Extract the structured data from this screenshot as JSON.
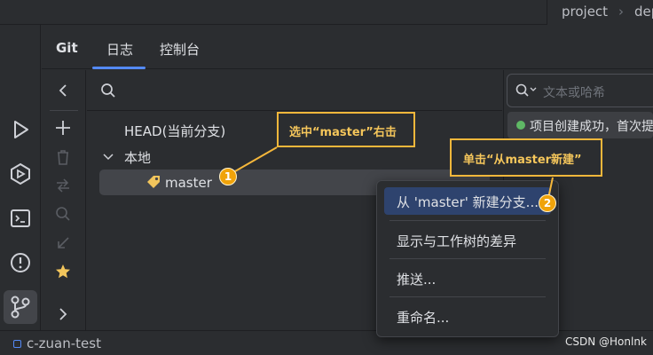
{
  "topbar": {
    "project": "project",
    "separator": "›",
    "path_fragment": "dep"
  },
  "tabs": [
    {
      "label": "Git"
    },
    {
      "label": "日志"
    },
    {
      "label": "控制台"
    }
  ],
  "tree": {
    "head": "HEAD(当前分支)",
    "local_group": "本地",
    "branch": "master"
  },
  "log": {
    "search_placeholder": "文本或哈希",
    "commit_message": "项目创建成功，首次提"
  },
  "context_menu": {
    "items": [
      {
        "label": "从 'master' 新建分支..."
      },
      {
        "label": "显示与工作树的差异"
      },
      {
        "label": "推送..."
      },
      {
        "label": "重命名..."
      }
    ]
  },
  "annotations": {
    "callout1": "选中“master”右击",
    "callout2": "单击“从master新建”",
    "step1": "1",
    "step2": "2"
  },
  "statusbar": {
    "project": "c-zuan-test",
    "watermark": "CSDN @Honlnk"
  },
  "colors": {
    "accent": "#548af7",
    "annotation": "#f5b73b",
    "selection": "#2e436e",
    "commit_dot": "#5fb865"
  }
}
